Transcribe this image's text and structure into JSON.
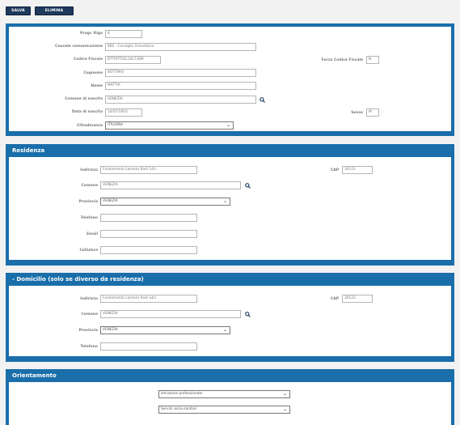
{
  "toolbar": {
    "save_label": "SALVA",
    "delete_label": "ELIMINA"
  },
  "anagrafica": {
    "prog_riga": {
      "label": "Progr. Riga",
      "value": "8"
    },
    "causale": {
      "label": "Causale comunicazione",
      "value": "800 - Consiglio Orientativo"
    },
    "codice_fiscale": {
      "label": "Codice Fiscale",
      "value": "BTTMTT03L14L736M"
    },
    "forza_cf": {
      "label": "Forza Codice Fiscale",
      "value": "N"
    },
    "cognome": {
      "label": "Cognome",
      "value": "BOTTARO"
    },
    "nome": {
      "label": "Nome",
      "value": "MATTIA"
    },
    "comune_nascita": {
      "label": "Comune di nascita",
      "value": "VENEZIA"
    },
    "data_nascita": {
      "label": "Data di nascita",
      "value": "14/07/2003"
    },
    "sesso": {
      "label": "Sesso",
      "value": "M"
    },
    "cittadinanza": {
      "label": "Cittadinanza",
      "value": "ITALIANA"
    }
  },
  "residenza": {
    "title": "Residenza",
    "indirizzo": {
      "label": "Indirizzo",
      "value": "Fondamenta Lorenzo Radi 14/c"
    },
    "cap": {
      "label": "CAP",
      "value": "30123"
    },
    "comune": {
      "label": "Comune",
      "value": "VENEZIA"
    },
    "provincia": {
      "label": "Provincia",
      "value": "VENEZIA"
    },
    "telefono": {
      "label": "Telefono",
      "value": ""
    },
    "email": {
      "label": "Email",
      "value": ""
    },
    "cellulare": {
      "label": "Cellulare",
      "value": ""
    }
  },
  "domicilio": {
    "title": "- Domicilio (solo se diverso da residenza)",
    "indirizzo": {
      "label": "Indirizzo",
      "value": "Fondamenta Lorenzo Radi 14/c"
    },
    "cap": {
      "label": "CAP",
      "value": "30123"
    },
    "comune": {
      "label": "Comune",
      "value": "VENEZIA"
    },
    "provincia": {
      "label": "Provincia",
      "value": "VENEZIA"
    },
    "telefono": {
      "label": "Telefono",
      "value": ""
    }
  },
  "orientamento": {
    "title": "Orientamento",
    "scelta1": "Istruzione professionale",
    "scelta2": "Servizi socio-sanitari"
  },
  "colors": {
    "panel": "#1a6eaa",
    "button": "#1f3a5c"
  },
  "icons": {
    "search": "search-icon",
    "dropdown": "chevron-down-icon"
  }
}
